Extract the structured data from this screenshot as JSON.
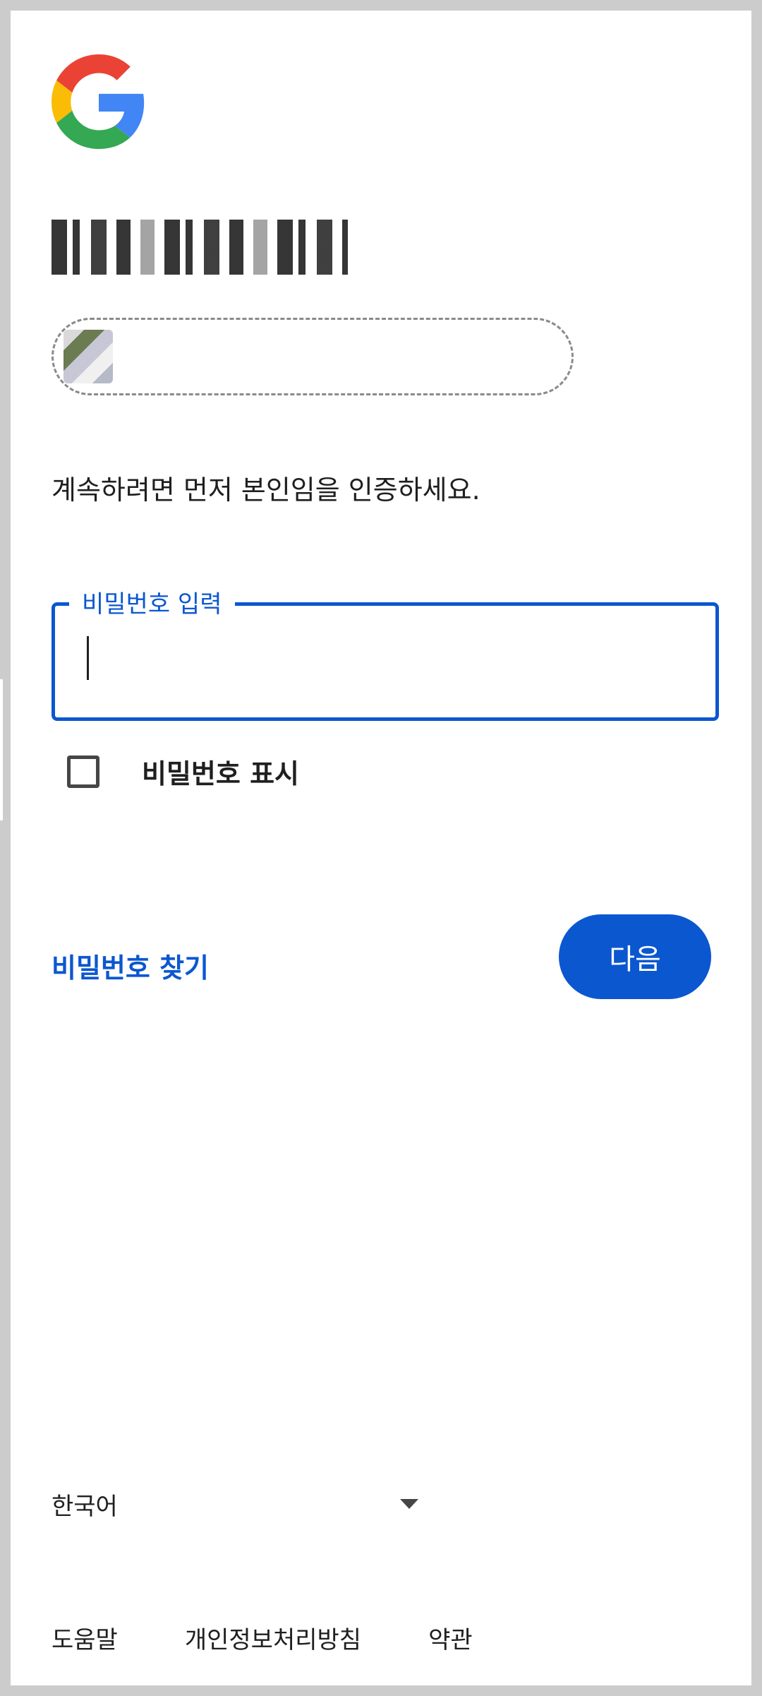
{
  "header": {
    "logo": "google-g-icon",
    "title_redacted": "",
    "account_email": "",
    "avatar": "account-avatar"
  },
  "prompt": {
    "subtitle": "계속하려면 먼저 본인임을 인증하세요."
  },
  "password_field": {
    "label": "비밀번호 입력",
    "value": "",
    "placeholder": ""
  },
  "show_password": {
    "label": "비밀번호 표시",
    "checked": false
  },
  "actions": {
    "forgot_label": "비밀번호 찾기",
    "next_label": "다음"
  },
  "footer": {
    "language": "한국어",
    "links": [
      "도움말",
      "개인정보처리방침",
      "약관"
    ]
  },
  "colors": {
    "accent": "#0b57d0",
    "text": "#1f1f1f",
    "background": "#ffffff",
    "frame": "#cccccc"
  }
}
